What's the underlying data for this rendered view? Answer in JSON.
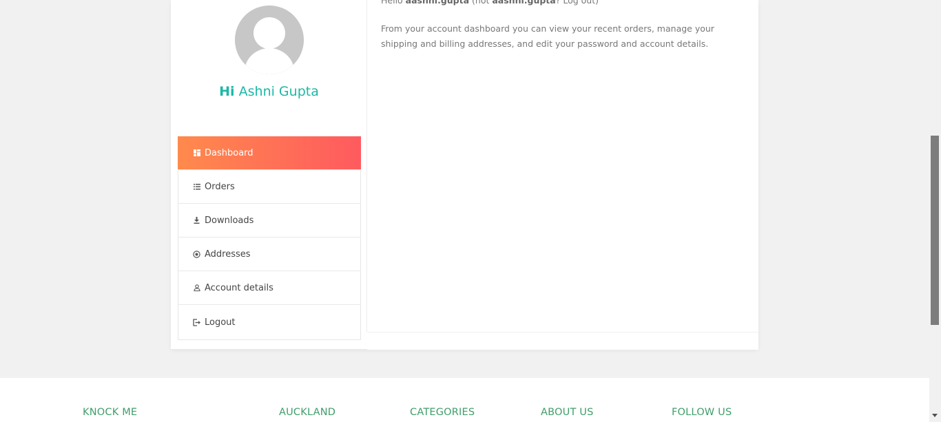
{
  "sidebar": {
    "greeting_hi": "Hi",
    "user_name": "Ashni Gupta",
    "items": [
      {
        "label": "Dashboard",
        "icon": "dashboard-icon",
        "active": true
      },
      {
        "label": "Orders",
        "icon": "list-icon",
        "active": false
      },
      {
        "label": "Downloads",
        "icon": "download-icon",
        "active": false
      },
      {
        "label": "Addresses",
        "icon": "location-icon",
        "active": false
      },
      {
        "label": "Account details",
        "icon": "user-icon",
        "active": false
      },
      {
        "label": "Logout",
        "icon": "logout-icon",
        "active": false
      }
    ]
  },
  "content": {
    "hello_prefix": "Hello",
    "username": "aashni.gupta",
    "not_prefix": "(not",
    "not_username": "aashni.gupta",
    "logout_link": "? Log out)",
    "intro_text": "From your account dashboard you can view your recent orders, manage your shipping and billing addresses, and edit your password and account details."
  },
  "footer": {
    "headings": [
      "KNOCK ME",
      "AUCKLAND",
      "CATEGORIES",
      "ABOUT US",
      "FOLLOW US"
    ]
  },
  "colors": {
    "accent_teal": "#1ab8a7",
    "active_gradient_start": "#ff8a4c",
    "active_gradient_end": "#ff5a5f",
    "footer_heading": "#3f9e6a"
  }
}
